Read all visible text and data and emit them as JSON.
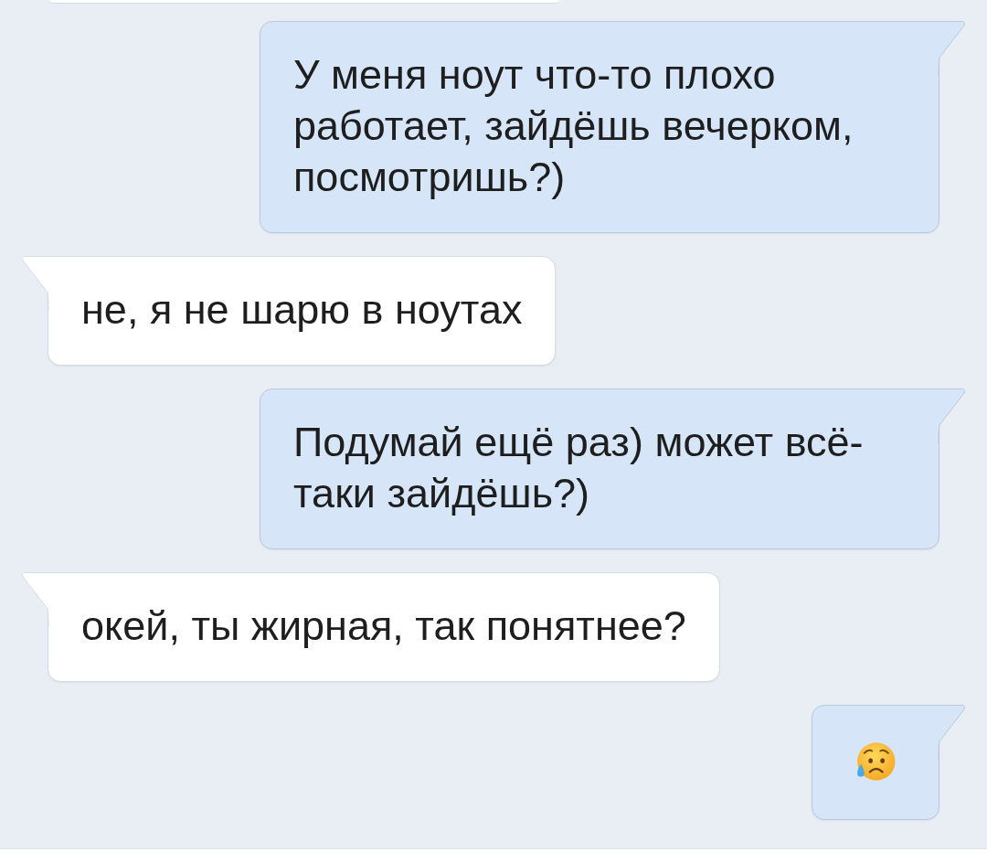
{
  "messages": [
    {
      "outgoing": false,
      "kind": "clipped"
    },
    {
      "outgoing": true,
      "kind": "text",
      "text": "У меня ноут что-то плохо работает, зайдёшь вечерком, посмотришь?)"
    },
    {
      "outgoing": false,
      "kind": "text",
      "text": "не, я не шарю в ноутах"
    },
    {
      "outgoing": true,
      "kind": "text",
      "text": "Подумай ещё раз) может всё-таки зайдёшь?)"
    },
    {
      "outgoing": false,
      "kind": "text",
      "text": "окей, ты жирная, так понятнее?"
    },
    {
      "outgoing": true,
      "kind": "emoji"
    }
  ]
}
